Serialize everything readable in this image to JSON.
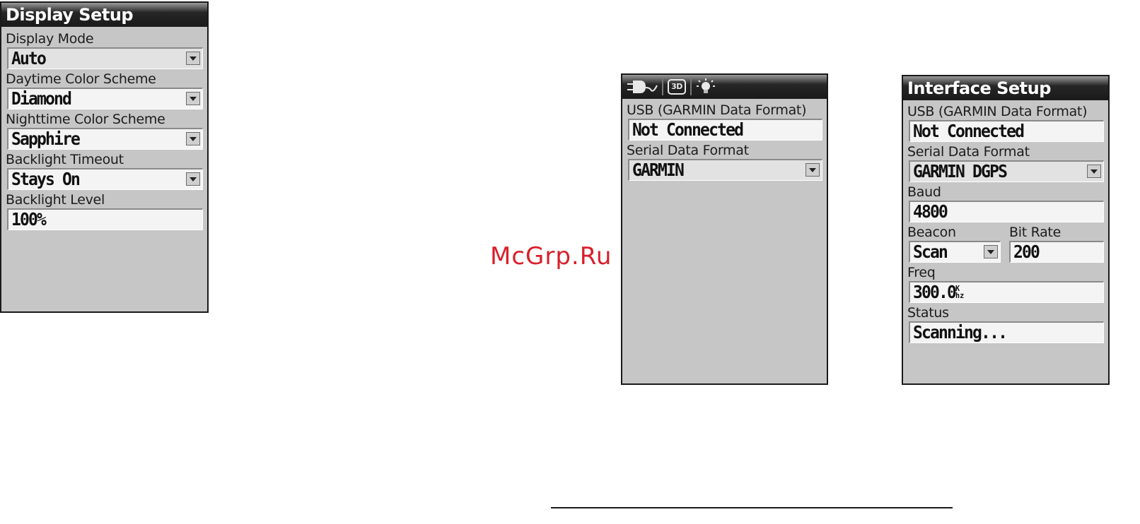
{
  "display_setup": {
    "title": "Display Setup",
    "display_mode": {
      "label": "Display Mode",
      "value": "Auto"
    },
    "daytime_color_scheme": {
      "label": "Daytime Color Scheme",
      "value": "Diamond"
    },
    "nighttime_color_scheme": {
      "label": "Nighttime Color Scheme",
      "value": "Sapphire"
    },
    "backlight_timeout": {
      "label": "Backlight Timeout",
      "value": "Stays On"
    },
    "backlight_level": {
      "label": "Backlight Level",
      "value": "100%"
    }
  },
  "watermark": "McGrp.Ru",
  "status_panel": {
    "icons": [
      "power-plug-icon",
      "3d-gps-icon",
      "backlight-bulb-icon"
    ],
    "gps_mode_text": "3D",
    "usb": {
      "label": "USB (GARMIN Data Format)",
      "value": "Not Connected"
    },
    "serial_format": {
      "label": "Serial Data Format",
      "value": "GARMIN"
    }
  },
  "interface_setup": {
    "title": "Interface Setup",
    "usb": {
      "label": "USB (GARMIN Data Format)",
      "value": "Not Connected"
    },
    "serial_format": {
      "label": "Serial Data Format",
      "value": "GARMIN DGPS"
    },
    "baud": {
      "label": "Baud",
      "value": "4800"
    },
    "beacon": {
      "label": "Beacon",
      "value": "Scan"
    },
    "bit_rate": {
      "label": "Bit Rate",
      "value": "200"
    },
    "freq": {
      "label": "Freq",
      "value": "300.0",
      "unit_top": "K",
      "unit_bottom": "hz"
    },
    "status": {
      "label": "Status",
      "value": "Scanning..."
    }
  },
  "colors": {
    "panel_bg": "#c6c6c6",
    "title_bar": "#1a1a1a",
    "field_bg": "#f4f4f4",
    "watermark": "#d8202a"
  }
}
